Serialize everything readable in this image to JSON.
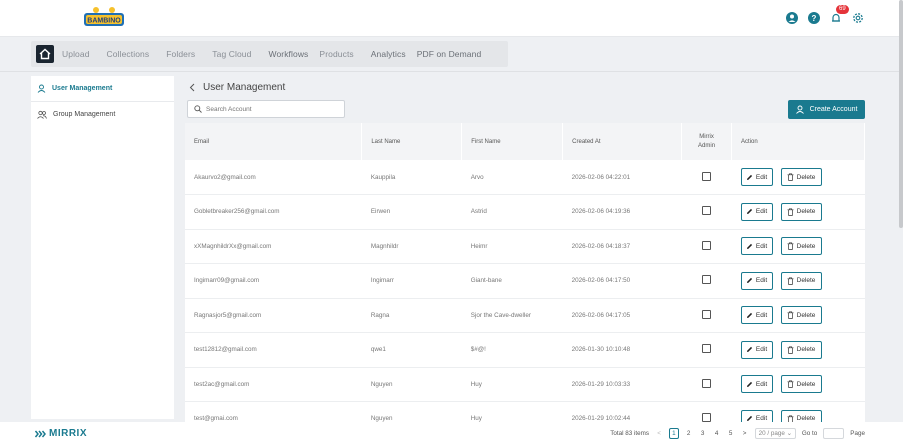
{
  "header": {
    "logo_text": "BAMBINO",
    "notification_count": "69"
  },
  "nav": {
    "items": [
      "Upload",
      "Collections",
      "Folders",
      "Tag Cloud",
      "Workflows",
      "Products",
      "Analytics",
      "PDF on Demand"
    ]
  },
  "sidebar": {
    "items": [
      {
        "label": "User Management",
        "active": true
      },
      {
        "label": "Group Management",
        "active": false
      }
    ]
  },
  "main": {
    "title": "User Management",
    "search_placeholder": "Search Account",
    "create_label": "Create Account"
  },
  "table": {
    "columns": [
      "Email",
      "Last Name",
      "First Name",
      "Created At",
      "Mirrix Admin",
      "Action"
    ],
    "edit_label": "Edit",
    "delete_label": "Delete",
    "rows": [
      {
        "email": "Akaurvo2@gmail.com",
        "last": "Kauppila",
        "first": "Arvo",
        "created": "2026-02-06 04:22:01"
      },
      {
        "email": "Gobletbreaker256@gmail.com",
        "last": "Eirwen",
        "first": "Astrid",
        "created": "2026-02-06 04:19:36"
      },
      {
        "email": "xXMagnhildrXx@gmail.com",
        "last": "Magnhildr",
        "first": "Heimr",
        "created": "2026-02-06 04:18:37"
      },
      {
        "email": "Ingimarr09@gmail.com",
        "last": "Ingimarr",
        "first": "Giant-bane",
        "created": "2026-02-06 04:17:50"
      },
      {
        "email": "Ragnasjor5@gmail.com",
        "last": "Ragna",
        "first": "Sjor the Cave-dweller",
        "created": "2026-02-06 04:17:05"
      },
      {
        "email": "test12812@gmail.com",
        "last": "qwe1",
        "first": "$#@!",
        "created": "2026-01-30 10:10:48"
      },
      {
        "email": "test2ac@gmail.com",
        "last": "Nguyen",
        "first": "Huy",
        "created": "2026-01-29 10:03:33"
      },
      {
        "email": "test@gmai.com",
        "last": "Nguyen",
        "first": "Huy",
        "created": "2026-01-29 10:02:44"
      }
    ]
  },
  "footer": {
    "brand": "MIRRIX",
    "total": "Total 83 items",
    "pages": [
      "1",
      "2",
      "3",
      "4",
      "5"
    ],
    "current_page": "1",
    "page_size": "20 / page",
    "goto_label": "Go to",
    "page_label": "Page"
  },
  "colors": {
    "accent": "#1a7a8f",
    "badge": "#e5343a"
  }
}
